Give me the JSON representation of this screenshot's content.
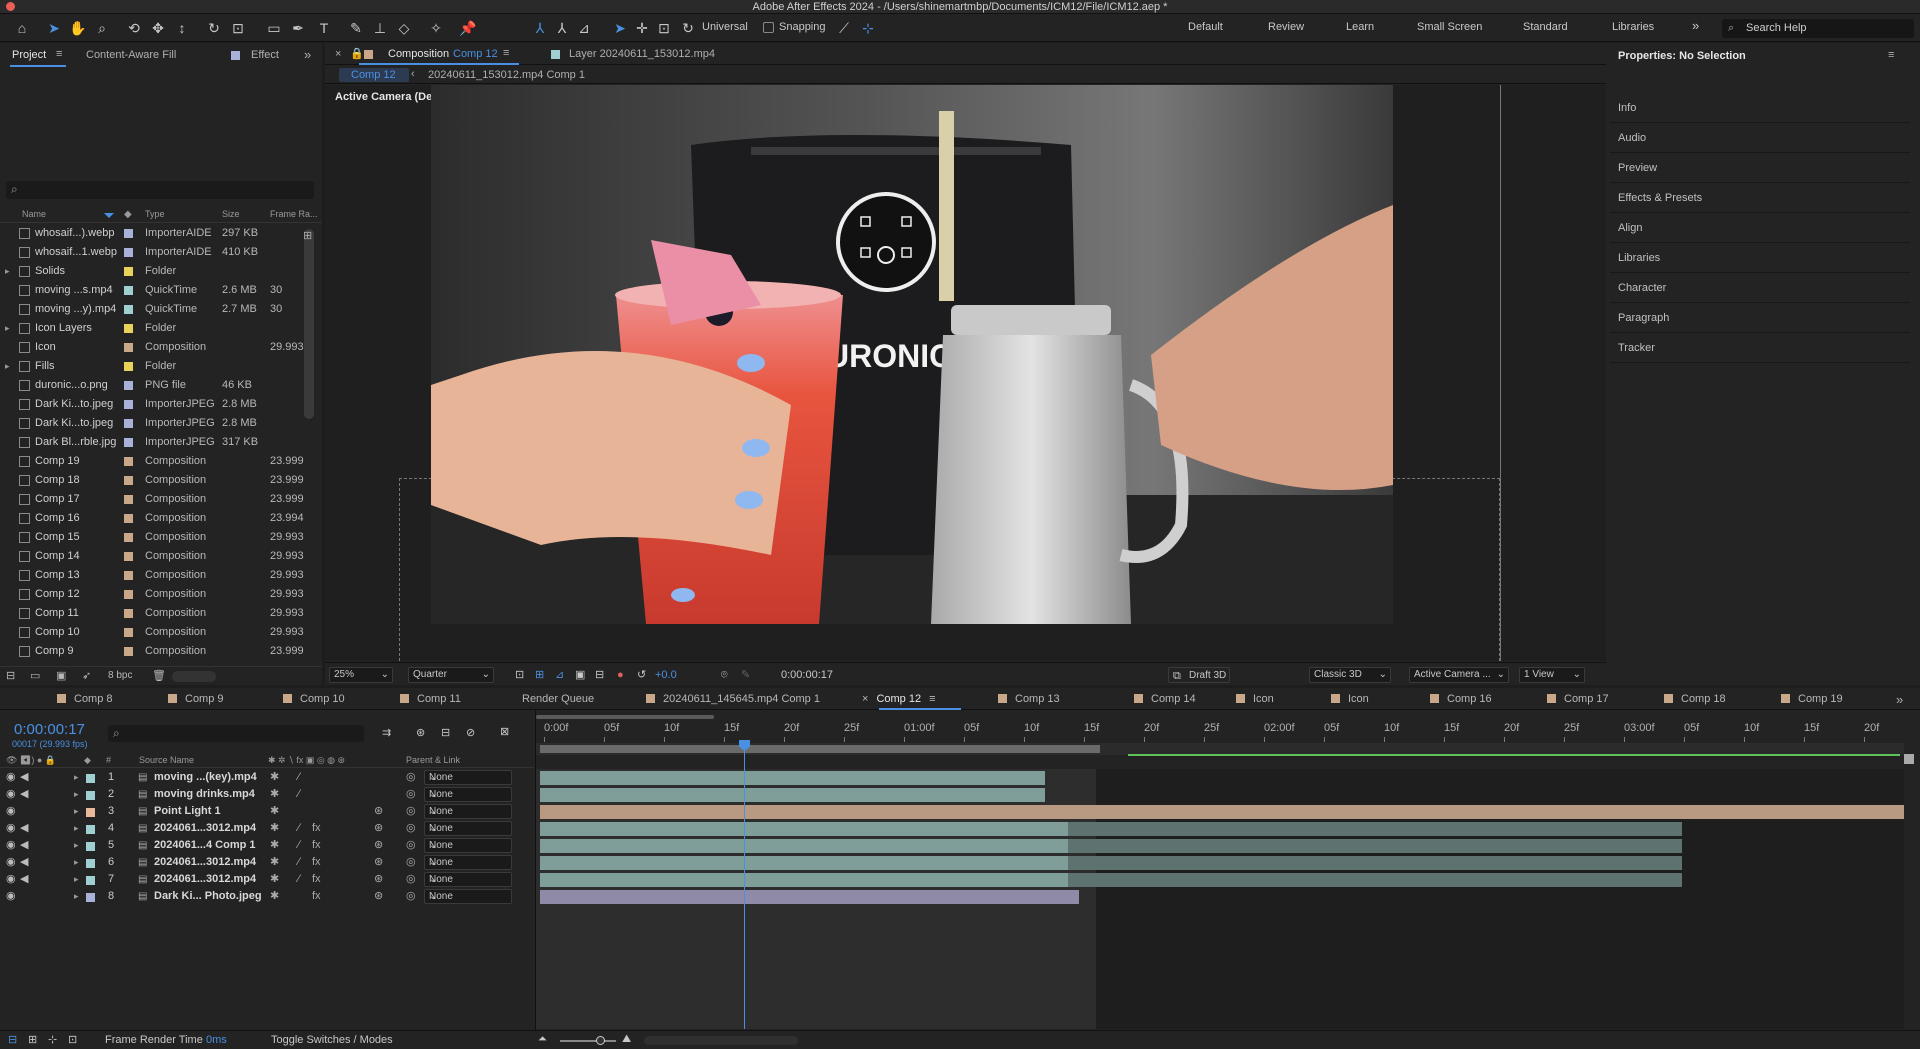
{
  "window": {
    "title": "Adobe After Effects 2024 - /Users/shinemartmbp/Documents/ICM12/File/ICM12.aep *"
  },
  "toolbar": {
    "universal_label": "Universal",
    "snapping_label": "Snapping",
    "workspaces": [
      "Default",
      "Review",
      "Learn",
      "Small Screen",
      "Standard",
      "Libraries"
    ],
    "search_placeholder": "Search Help"
  },
  "project_panel": {
    "tabs": [
      "Project",
      "Content-Aware Fill",
      "Effect"
    ],
    "columns": [
      "Name",
      "Type",
      "Size",
      "Frame Ra..."
    ],
    "bpc": "8 bpc",
    "items": [
      {
        "name": "whosaif...).webp",
        "type": "ImporterAIDE",
        "size": "297 KB",
        "rate": "",
        "color": "#a9b1d9",
        "icon": "file"
      },
      {
        "name": "whosaif...1.webp",
        "type": "ImporterAIDE",
        "size": "410 KB",
        "rate": "",
        "color": "#a9b1d9",
        "icon": "file"
      },
      {
        "name": "Solids",
        "type": "Folder",
        "size": "",
        "rate": "",
        "color": "#e8d25a",
        "icon": "folder"
      },
      {
        "name": "moving ...s.mp4",
        "type": "QuickTime",
        "size": "2.6 MB",
        "rate": "30",
        "color": "#9fcfd0",
        "icon": "file"
      },
      {
        "name": "moving ...y).mp4",
        "type": "QuickTime",
        "size": "2.7 MB",
        "rate": "30",
        "color": "#9fcfd0",
        "icon": "file"
      },
      {
        "name": "Icon Layers",
        "type": "Folder",
        "size": "",
        "rate": "",
        "color": "#e8d25a",
        "icon": "folder"
      },
      {
        "name": "Icon",
        "type": "Composition",
        "size": "",
        "rate": "29.993",
        "color": "#c9a789",
        "icon": "comp"
      },
      {
        "name": "Fills",
        "type": "Folder",
        "size": "",
        "rate": "",
        "color": "#e8d25a",
        "icon": "folder"
      },
      {
        "name": "duronic...o.png",
        "type": "PNG file",
        "size": "46 KB",
        "rate": "",
        "color": "#a9b1d9",
        "icon": "file"
      },
      {
        "name": "Dark Ki...to.jpeg",
        "type": "ImporterJPEG",
        "size": "2.8 MB",
        "rate": "",
        "color": "#a9b1d9",
        "icon": "file"
      },
      {
        "name": "Dark Ki...to.jpeg",
        "type": "ImporterJPEG",
        "size": "2.8 MB",
        "rate": "",
        "color": "#a9b1d9",
        "icon": "file"
      },
      {
        "name": "Dark Bl...rble.jpg",
        "type": "ImporterJPEG",
        "size": "317 KB",
        "rate": "",
        "color": "#a9b1d9",
        "icon": "file"
      },
      {
        "name": "Comp 19",
        "type": "Composition",
        "size": "",
        "rate": "23.999",
        "color": "#c9a789",
        "icon": "comp"
      },
      {
        "name": "Comp 18",
        "type": "Composition",
        "size": "",
        "rate": "23.999",
        "color": "#c9a789",
        "icon": "comp"
      },
      {
        "name": "Comp 17",
        "type": "Composition",
        "size": "",
        "rate": "23.999",
        "color": "#c9a789",
        "icon": "comp"
      },
      {
        "name": "Comp 16",
        "type": "Composition",
        "size": "",
        "rate": "23.994",
        "color": "#c9a789",
        "icon": "comp"
      },
      {
        "name": "Comp 15",
        "type": "Composition",
        "size": "",
        "rate": "29.993",
        "color": "#c9a789",
        "icon": "comp"
      },
      {
        "name": "Comp 14",
        "type": "Composition",
        "size": "",
        "rate": "29.993",
        "color": "#c9a789",
        "icon": "comp"
      },
      {
        "name": "Comp 13",
        "type": "Composition",
        "size": "",
        "rate": "29.993",
        "color": "#c9a789",
        "icon": "comp"
      },
      {
        "name": "Comp 12",
        "type": "Composition",
        "size": "",
        "rate": "29.993",
        "color": "#c9a789",
        "icon": "comp"
      },
      {
        "name": "Comp 11",
        "type": "Composition",
        "size": "",
        "rate": "29.993",
        "color": "#c9a789",
        "icon": "comp"
      },
      {
        "name": "Comp 10",
        "type": "Composition",
        "size": "",
        "rate": "29.993",
        "color": "#c9a789",
        "icon": "comp"
      },
      {
        "name": "Comp 9",
        "type": "Composition",
        "size": "",
        "rate": "23.999",
        "color": "#c9a789",
        "icon": "comp"
      }
    ]
  },
  "viewer": {
    "tab_prefix": "Composition",
    "tab_comp": "Comp 12",
    "layer_tab": "Layer 20240611_153012.mp4",
    "crumb_active": "Comp 12",
    "crumb_next": "20240611_153012.mp4 Comp 1",
    "camera_label": "Active Camera (Default)",
    "brand_text": "URONIC",
    "controls": {
      "zoom": "25%",
      "resolution": "Quarter",
      "exposure": "+0.0",
      "timecode": "0:00:00:17",
      "draft3d": "Draft 3D",
      "renderer": "Classic 3D",
      "camera": "Active Camera ...",
      "views": "1 View"
    }
  },
  "properties_panel": {
    "title": "Properties: No Selection",
    "items": [
      "Info",
      "Audio",
      "Preview",
      "Effects & Presets",
      "Align",
      "Libraries",
      "Character",
      "Paragraph",
      "Tracker"
    ]
  },
  "timeline": {
    "tabs": [
      {
        "label": "Comp 8",
        "color": "#c9a789"
      },
      {
        "label": "Comp 9",
        "color": "#c9a789"
      },
      {
        "label": "Comp 10",
        "color": "#c9a789"
      },
      {
        "label": "Comp 11",
        "color": "#c9a789"
      },
      {
        "label": "Render Queue",
        "color": ""
      },
      {
        "label": "20240611_145645.mp4 Comp 1",
        "color": "#c9a789"
      },
      {
        "label": "Comp 12",
        "color": "",
        "active": true
      },
      {
        "label": "Comp 13",
        "color": "#c9a789"
      },
      {
        "label": "Comp 14",
        "color": "#c9a789"
      },
      {
        "label": "Icon",
        "color": "#c9a789"
      },
      {
        "label": "Icon",
        "color": "#c9a789"
      },
      {
        "label": "Comp 16",
        "color": "#c9a789"
      },
      {
        "label": "Comp 17",
        "color": "#c9a789"
      },
      {
        "label": "Comp 18",
        "color": "#c9a789"
      },
      {
        "label": "Comp 19",
        "color": "#c9a789"
      }
    ],
    "current_time": "0:00:00:17",
    "frame_info": "00017 (29.993 fps)",
    "col_source": "Source Name",
    "col_parent": "Parent & Link",
    "layers": [
      {
        "num": "1",
        "name": "moving ...(key).mp4",
        "parent": "None",
        "color": "#9fcfd0",
        "audio": true,
        "bar_color": "#7f9e9a",
        "bar_start": 0.0,
        "bar_end": 0.37
      },
      {
        "num": "2",
        "name": "moving drinks.mp4",
        "parent": "None",
        "color": "#9fcfd0",
        "audio": true,
        "bar_color": "#7f9e9a",
        "bar_start": 0.0,
        "bar_end": 0.37
      },
      {
        "num": "3",
        "name": "Point Light 1",
        "parent": "None",
        "color": "#e8b89a",
        "audio": false,
        "bar_color": "#b89a83",
        "bar_start": 0.0,
        "bar_end": 1.0
      },
      {
        "num": "4",
        "name": "2024061...3012.mp4",
        "parent": "None",
        "color": "#9fcfd0",
        "audio": true,
        "bar_color": "#7f9e9a",
        "bar_start": 0.0,
        "bar_end": 0.387,
        "tail_end": 0.837
      },
      {
        "num": "5",
        "name": "2024061...4 Comp 1",
        "parent": "None",
        "color": "#9fcfd0",
        "audio": true,
        "bar_color": "#7f9e9a",
        "bar_start": 0.0,
        "bar_end": 0.387,
        "tail_end": 0.837
      },
      {
        "num": "6",
        "name": "2024061...3012.mp4",
        "parent": "None",
        "color": "#9fcfd0",
        "audio": true,
        "bar_color": "#7f9e9a",
        "bar_start": 0.0,
        "bar_end": 0.387,
        "tail_end": 0.837
      },
      {
        "num": "7",
        "name": "2024061...3012.mp4",
        "parent": "None",
        "color": "#9fcfd0",
        "audio": true,
        "bar_color": "#7f9e9a",
        "bar_start": 0.0,
        "bar_end": 0.387,
        "tail_end": 0.837
      },
      {
        "num": "8",
        "name": "Dark Ki... Photo.jpeg",
        "parent": "None",
        "color": "#a9b1d9",
        "audio": false,
        "bar_color": "#8f8aa8",
        "bar_start": 0.0,
        "bar_end": 0.395
      }
    ],
    "ruler_labels": [
      "0:00f",
      "05f",
      "10f",
      "15f",
      "20f",
      "25f",
      "01:00f",
      "05f",
      "10f",
      "15f",
      "20f",
      "25f",
      "02:00f",
      "05f",
      "10f",
      "15f",
      "20f",
      "25f",
      "03:00f",
      "05f",
      "10f",
      "15f",
      "20f"
    ],
    "playhead_fraction": 0.152,
    "work_area_end_fraction": 0.409,
    "bottom": {
      "render_time_label": "Frame Render Time",
      "render_time_value": "0ms",
      "toggle_label": "Toggle Switches / Modes"
    }
  },
  "colors": {
    "accent": "#4a90e2",
    "work_area": "#5fc35a"
  }
}
